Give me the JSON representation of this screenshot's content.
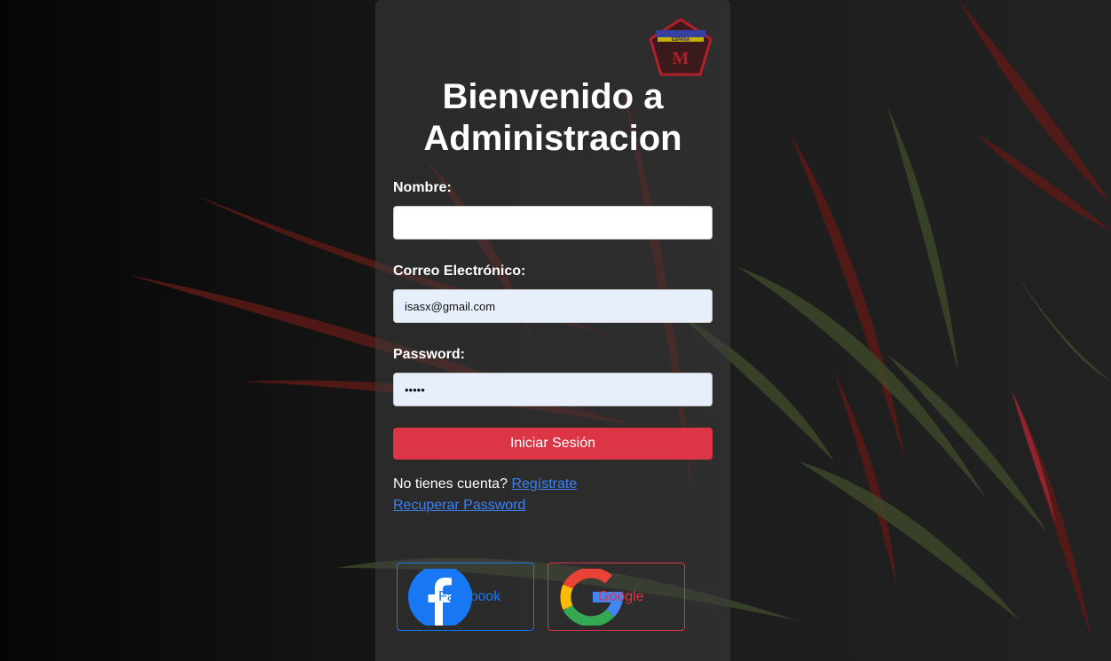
{
  "login": {
    "title": "Bienvenido a Administracion",
    "logo": {
      "icon": "logo-pentagon-icon",
      "top_text": "ESPAÑA",
      "letter": "M"
    },
    "name_label": "Nombre:",
    "name_value": "",
    "email_label": "Correo Electrónico:",
    "email_value": "isasx@gmail.com",
    "password_label": "Password:",
    "password_value": "•••••",
    "submit_label": "Iniciar Sesión",
    "no_account_text": "No tienes cuenta?",
    "register_link": "Regístrate",
    "recover_link": "Recuperar Password",
    "facebook_label": "Facebook",
    "google_label": "Google"
  },
  "colors": {
    "primary_button": "#dc3545",
    "link": "#3b82f6",
    "facebook": "#1877f2",
    "google_border": "#dc3545"
  }
}
